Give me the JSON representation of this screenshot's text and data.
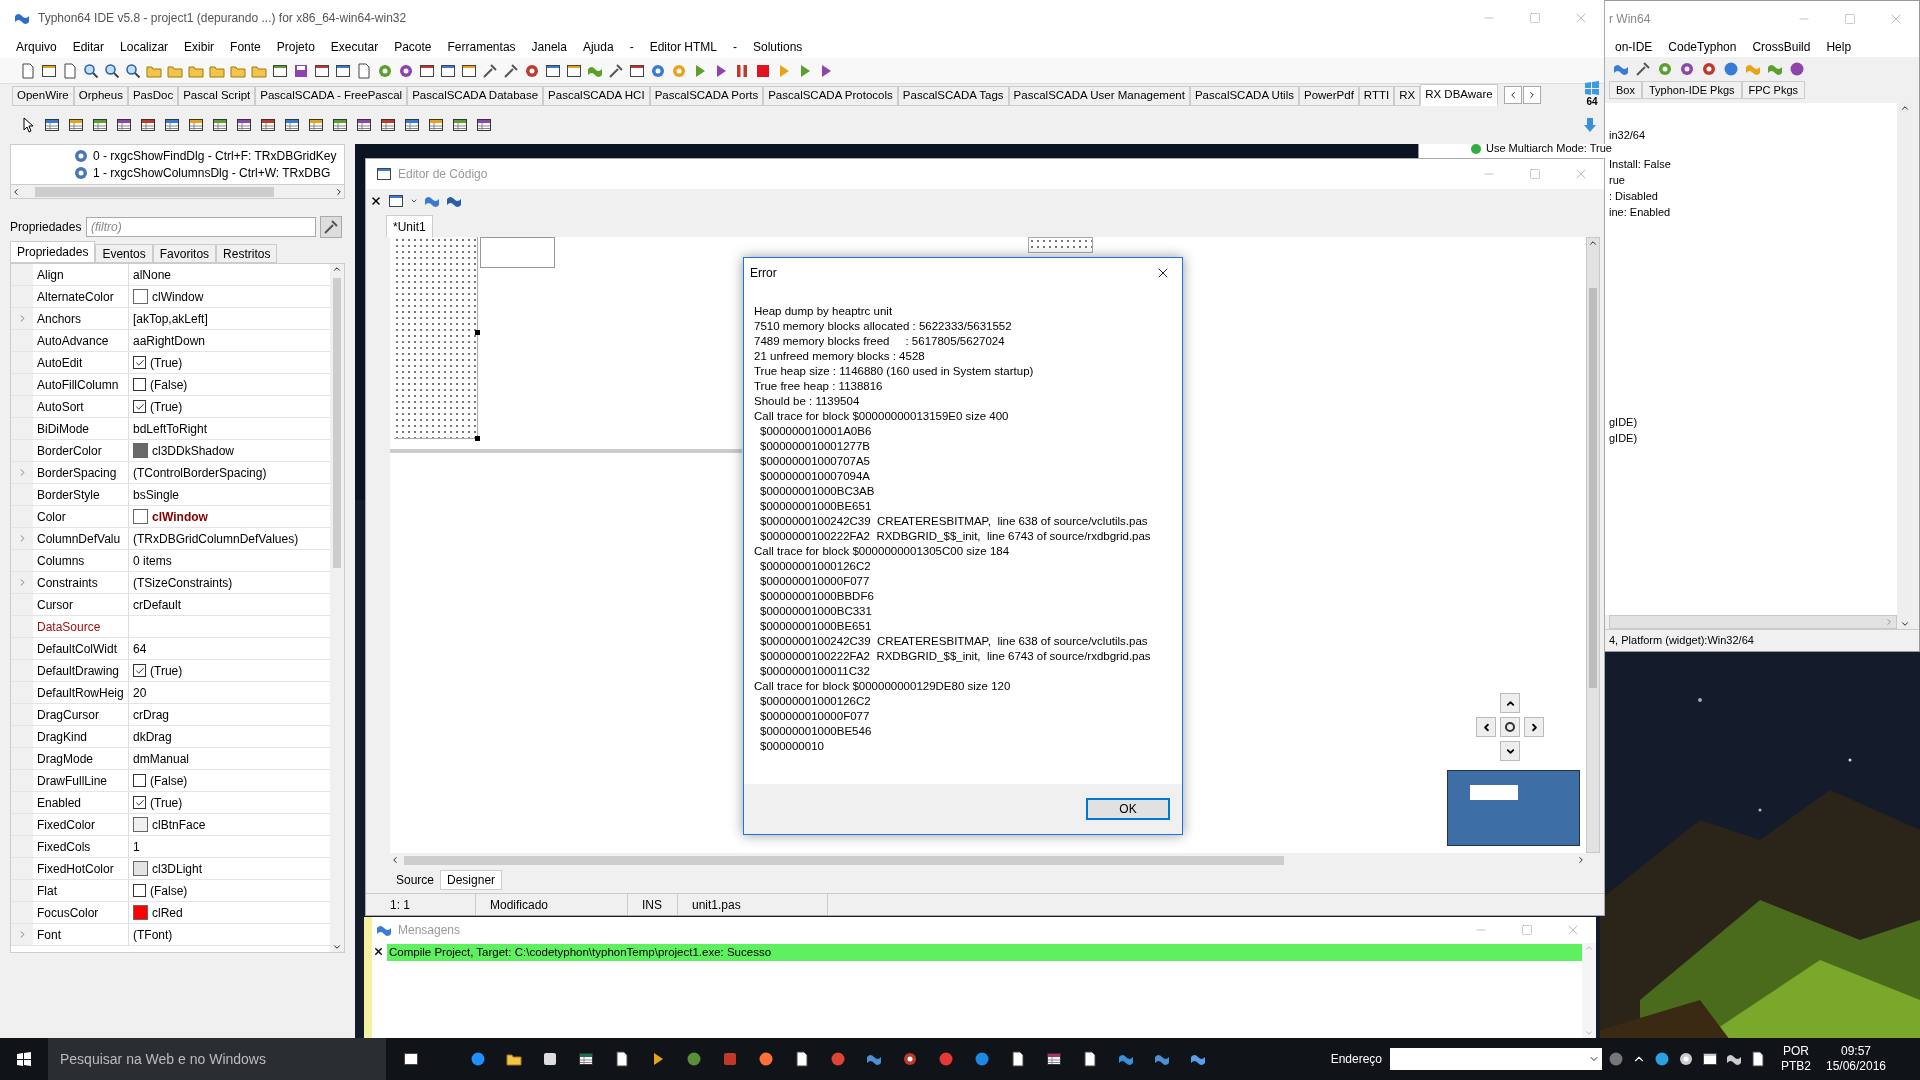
{
  "ide": {
    "title": "Typhon64 IDE v5.8 - project1 (depurando ...) for x86_64-win64-win32",
    "menu": [
      "Arquivo",
      "Editar",
      "Localizar",
      "Exibir",
      "Fonte",
      "Projeto",
      "Executar",
      "Pacote",
      "Ferramentas",
      "Janela",
      "Ajuda",
      "-",
      "Editor HTML",
      "-",
      "Solutions"
    ],
    "palette_tabs": [
      {
        "label": "OpenWire",
        "selected": false
      },
      {
        "label": "Orpheus",
        "selected": false
      },
      {
        "label": "PasDoc",
        "selected": false
      },
      {
        "label": "Pascal Script",
        "selected": false
      },
      {
        "label": "PascalSCADA - FreePascal",
        "selected": false
      },
      {
        "label": "PascalSCADA Database",
        "selected": false
      },
      {
        "label": "PascalSCADA HCI",
        "selected": false
      },
      {
        "label": "PascalSCADA Ports",
        "selected": false
      },
      {
        "label": "PascalSCADA Protocols",
        "selected": false
      },
      {
        "label": "PascalSCADA Tags",
        "selected": false
      },
      {
        "label": "PascalSCADA User Management",
        "selected": false
      },
      {
        "label": "PascalSCADA Utils",
        "selected": false
      },
      {
        "label": "PowerPdf",
        "selected": false
      },
      {
        "label": "RTTI",
        "selected": false
      },
      {
        "label": "RX",
        "selected": false
      },
      {
        "label": "RX DBAware",
        "selected": true
      }
    ],
    "palette_badge": "64"
  },
  "center_window": {
    "title": "r Win64",
    "menu": [
      "on-IDE",
      "CodeTyphon",
      "CrossBuild",
      "Help"
    ],
    "tabs": [
      "Box",
      "Typhon-IDE Pkgs",
      "FPC Pkgs"
    ],
    "lines": [
      {
        "text": "in32/64",
        "kind": "clipped"
      },
      {
        "text": "Use Multiarch Mode: True",
        "kind": "status"
      },
      {
        "text": "Install: False",
        "kind": "clipped"
      },
      {
        "text": "rue",
        "kind": "clipped"
      },
      {
        "text": ": Disabled",
        "kind": "clipped"
      },
      {
        "text": "ine: Enabled",
        "kind": "clipped"
      }
    ],
    "more_lines": [
      "gIDE)",
      "gIDE)"
    ],
    "status": "4, Platform (widget):Win32/64"
  },
  "inspector": {
    "tree_items": [
      "0 - rxgcShowFindDlg - Ctrl+F: TRxDBGridKey",
      "1 - rxgcShowColumnsDlg - Ctrl+W: TRxDBG"
    ],
    "filter_label": "Propriedades",
    "filter_placeholder": "(filtro)",
    "tabs": [
      {
        "label": "Propriedades",
        "selected": true
      },
      {
        "label": "Eventos",
        "selected": false
      },
      {
        "label": "Favoritos",
        "selected": false
      },
      {
        "label": "Restritos",
        "selected": false
      }
    ],
    "rows": [
      {
        "name": "Align",
        "value": "alNone",
        "kind": "text",
        "expandable": false,
        "required": false
      },
      {
        "name": "AlternateColor",
        "value": "clWindow",
        "kind": "color",
        "color": "#ffffff",
        "expandable": false,
        "required": false
      },
      {
        "name": "Anchors",
        "value": "[akTop,akLeft]",
        "kind": "text",
        "expandable": true,
        "required": false
      },
      {
        "name": "AutoAdvance",
        "value": "aaRightDown",
        "kind": "text",
        "expandable": false,
        "required": false
      },
      {
        "name": "AutoEdit",
        "value": "(True)",
        "kind": "check",
        "checked": true,
        "expandable": false,
        "required": false
      },
      {
        "name": "AutoFillColumn",
        "value": "(False)",
        "kind": "check",
        "checked": false,
        "expandable": false,
        "required": false
      },
      {
        "name": "AutoSort",
        "value": "(True)",
        "kind": "check",
        "checked": true,
        "expandable": false,
        "required": false
      },
      {
        "name": "BiDiMode",
        "value": "bdLeftToRight",
        "kind": "text",
        "expandable": false,
        "required": false
      },
      {
        "name": "BorderColor",
        "value": "cl3DDkShadow",
        "kind": "color",
        "color": "#696969",
        "expandable": false,
        "required": false
      },
      {
        "name": "BorderSpacing",
        "value": "(TControlBorderSpacing)",
        "kind": "text",
        "expandable": true,
        "required": false
      },
      {
        "name": "BorderStyle",
        "value": "bsSingle",
        "kind": "text",
        "expandable": false,
        "required": false
      },
      {
        "name": "Color",
        "value": "clWindow",
        "kind": "color",
        "color": "#ffffff",
        "expandable": false,
        "modified": true,
        "required": false
      },
      {
        "name": "ColumnDefValu",
        "value": "(TRxDBGridColumnDefValues)",
        "kind": "text",
        "expandable": true,
        "required": false
      },
      {
        "name": "Columns",
        "value": "0 items",
        "kind": "text",
        "expandable": false,
        "required": false
      },
      {
        "name": "Constraints",
        "value": "(TSizeConstraints)",
        "kind": "text",
        "expandable": true,
        "required": false
      },
      {
        "name": "Cursor",
        "value": "crDefault",
        "kind": "text",
        "expandable": false,
        "required": false
      },
      {
        "name": "DataSource",
        "kind": "text",
        "expandable": false,
        "required": true
      },
      {
        "name": "DefaultColWidt",
        "value": "64",
        "kind": "text",
        "expandable": false,
        "required": false
      },
      {
        "name": "DefaultDrawing",
        "value": "(True)",
        "kind": "check",
        "checked": true,
        "expandable": false,
        "required": false
      },
      {
        "name": "DefaultRowHeig",
        "value": "20",
        "kind": "text",
        "expandable": false,
        "required": false
      },
      {
        "name": "DragCursor",
        "value": "crDrag",
        "kind": "text",
        "expandable": false,
        "required": false
      },
      {
        "name": "DragKind",
        "value": "dkDrag",
        "kind": "text",
        "expandable": false,
        "required": false
      },
      {
        "name": "DragMode",
        "value": "dmManual",
        "kind": "text",
        "expandable": false,
        "required": false
      },
      {
        "name": "DrawFullLine",
        "value": "(False)",
        "kind": "check",
        "checked": false,
        "expandable": false,
        "required": false
      },
      {
        "name": "Enabled",
        "value": "(True)",
        "kind": "check",
        "checked": true,
        "expandable": false,
        "required": false
      },
      {
        "name": "FixedColor",
        "value": "clBtnFace",
        "kind": "color",
        "color": "#f0f0f0",
        "expandable": false,
        "required": false
      },
      {
        "name": "FixedCols",
        "value": "1",
        "kind": "text",
        "expandable": false,
        "required": false
      },
      {
        "name": "FixedHotColor",
        "value": "cl3DLight",
        "kind": "color",
        "color": "#e3e3e3",
        "expandable": false,
        "required": false
      },
      {
        "name": "Flat",
        "value": "(False)",
        "kind": "check",
        "checked": false,
        "expandable": false,
        "required": false
      },
      {
        "name": "FocusColor",
        "value": "clRed",
        "kind": "color",
        "color": "#ff0000",
        "expandable": false,
        "required": false
      },
      {
        "name": "Font",
        "value": "(TFont)",
        "kind": "text",
        "expandable": true,
        "required": false
      }
    ]
  },
  "editor": {
    "title": "Editor de Código",
    "tabs": [
      {
        "label": "*Unit1",
        "selected": true
      }
    ],
    "view_tabs": [
      {
        "label": "Source",
        "selected": false
      },
      {
        "label": "Designer",
        "selected": true
      }
    ],
    "status": [
      "1: 1",
      "Modificado",
      "INS",
      "unit1.pas"
    ]
  },
  "error_dialog": {
    "title": "Error",
    "button": "OK",
    "lines": [
      {
        "text": "Heap dump by heaptrc unit",
        "kind": "header"
      },
      {
        "text": "7510 memory blocks allocated : 5622333/5631552",
        "kind": "header"
      },
      {
        "text": "7489 memory blocks freed     : 5617805/5627024",
        "kind": "header"
      },
      {
        "text": "21 unfreed memory blocks : 4528",
        "kind": "header"
      },
      {
        "text": "True heap size : 1146880 (160 used in System startup)",
        "kind": "header"
      },
      {
        "text": "True free heap : 1138816",
        "kind": "header"
      },
      {
        "text": "Should be : 1139504",
        "kind": "header"
      },
      {
        "text": "Call trace for block $00000000013159E0 size 400",
        "kind": "header"
      },
      {
        "text": "$000000010001A0B6",
        "kind": "frame"
      },
      {
        "text": "$000000010001277B",
        "kind": "frame"
      },
      {
        "text": "$00000001000707A5",
        "kind": "frame"
      },
      {
        "text": "$000000010007094A",
        "kind": "frame"
      },
      {
        "text": "$00000001000BC3AB",
        "kind": "frame"
      },
      {
        "text": "$00000001000BE651",
        "kind": "frame"
      },
      {
        "text": "$0000000100242C39  CREATERESBITMAP,  line 638 of source/vclutils.pas",
        "kind": "frame"
      },
      {
        "text": "$0000000100222FA2  RXDBGRID_$$_init,  line 6743 of source/rxdbgrid.pas",
        "kind": "frame"
      },
      {
        "text": "Call trace for block $0000000001305C00 size 184",
        "kind": "header"
      },
      {
        "text": "$00000001000126C2",
        "kind": "frame"
      },
      {
        "text": "$000000010000F077",
        "kind": "frame"
      },
      {
        "text": "$00000001000BBDF6",
        "kind": "frame"
      },
      {
        "text": "$00000001000BC331",
        "kind": "frame"
      },
      {
        "text": "$00000001000BE651",
        "kind": "frame"
      },
      {
        "text": "$0000000100242C39  CREATERESBITMAP,  line 638 of source/vclutils.pas",
        "kind": "frame"
      },
      {
        "text": "$0000000100222FA2  RXDBGRID_$$_init,  line 6743 of source/rxdbgrid.pas",
        "kind": "frame"
      },
      {
        "text": "$0000000100011C32",
        "kind": "frame"
      },
      {
        "text": "Call trace for block $000000000129DE80 size 120",
        "kind": "header"
      },
      {
        "text": "$00000001000126C2",
        "kind": "frame"
      },
      {
        "text": "$000000010000F077",
        "kind": "frame"
      },
      {
        "text": "$00000001000BE546",
        "kind": "frame"
      },
      {
        "text": "$000000010",
        "kind": "frame"
      }
    ]
  },
  "messages": {
    "title": "Mensagens",
    "items": [
      {
        "text": "Compile Project, Target: C:\\codetyphon\\typhonTemp\\project1.exe: Sucesso",
        "color": "#5ef05e"
      }
    ]
  },
  "taskbar": {
    "search_placeholder": "Pesquisar na Web e no Windows",
    "address_label": "Endereço",
    "language": "POR",
    "layout": "PTB2",
    "time": "09:57",
    "date": "15/06/2016"
  }
}
